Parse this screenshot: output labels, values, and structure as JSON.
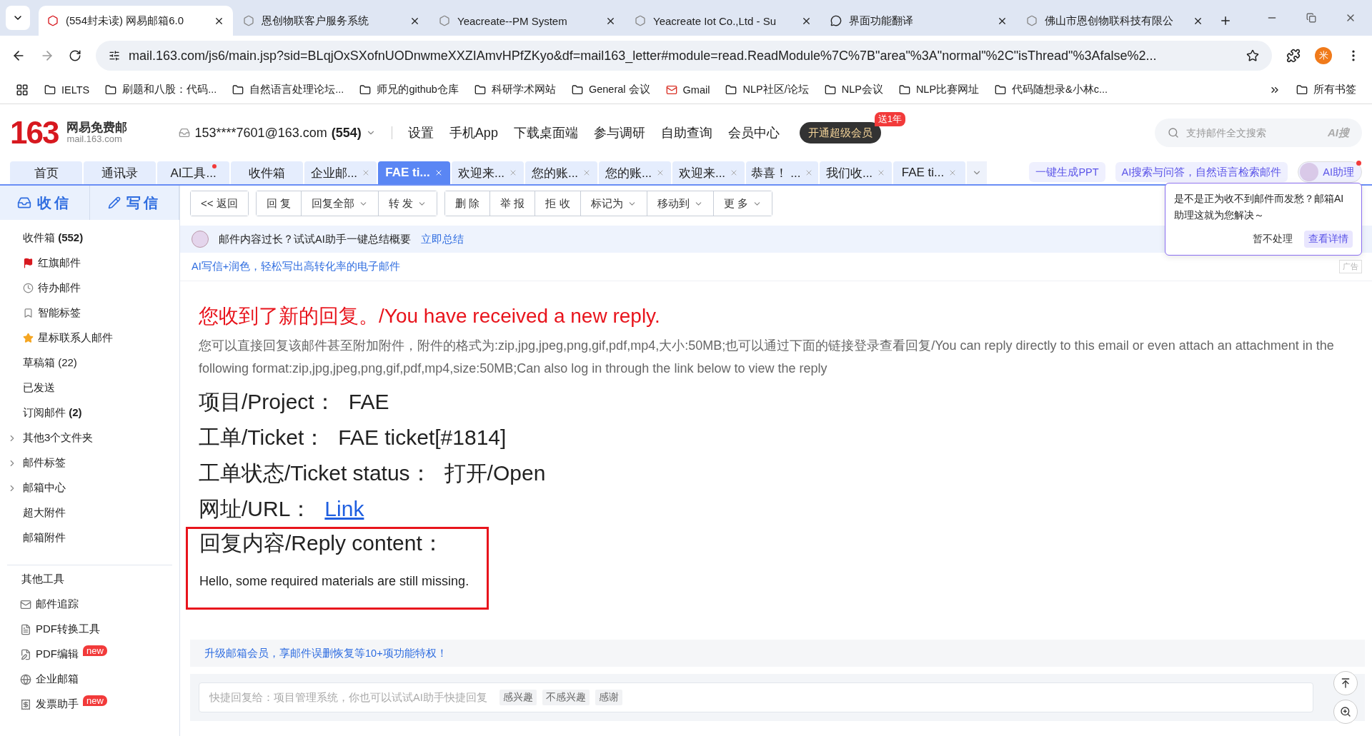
{
  "browser": {
    "tabs": [
      {
        "title": "(554封未读) 网易邮箱6.0",
        "kind": "mail",
        "selected": true
      },
      {
        "title": "恩创物联客户服务系统",
        "kind": "site",
        "selected": false
      },
      {
        "title": "Yeacreate--PM System",
        "kind": "site",
        "selected": false
      },
      {
        "title": "Yeacreate Iot Co.,Ltd - Su",
        "kind": "site",
        "selected": false
      },
      {
        "title": "界面功能翻译",
        "kind": "chat",
        "selected": false
      },
      {
        "title": "佛山市恩创物联科技有限公",
        "kind": "site",
        "selected": false
      }
    ],
    "url": "mail.163.com/js6/main.jsp?sid=BLqjOxSXofnUODnwmeXXZIAmvHPfZKyo&df=mail163_letter#module=read.ReadModule%7C%7B\"area\"%3A\"normal\"%2C\"isThread\"%3Afalse%2...",
    "profile": "米",
    "bookmarks": [
      {
        "label": "IELTS",
        "kind": "folder"
      },
      {
        "label": "刷题和八股：代码...",
        "kind": "folder"
      },
      {
        "label": "自然语言处理论坛...",
        "kind": "folder"
      },
      {
        "label": "师兄的github仓库",
        "kind": "folder"
      },
      {
        "label": "科研学术网站",
        "kind": "folder"
      },
      {
        "label": "General 会议",
        "kind": "folder"
      },
      {
        "label": "Gmail",
        "kind": "gmail"
      },
      {
        "label": "NLP社区/论坛",
        "kind": "folder"
      },
      {
        "label": "NLP会议",
        "kind": "folder"
      },
      {
        "label": "NLP比赛网址",
        "kind": "folder"
      },
      {
        "label": "代码随想录&小林c...",
        "kind": "folder"
      }
    ],
    "all_bookmarks": "所有书签"
  },
  "header": {
    "logo_number": "163",
    "logo_name": "网易免费邮",
    "logo_domain": "mail.163.com",
    "account": "153****7601@163.com",
    "account_count": "(554)",
    "nav": [
      "设置",
      "手机App",
      "下载桌面端",
      "参与调研",
      "自助查询",
      "会员中心"
    ],
    "vip_button": "开通超级会员",
    "vip_badge": "送1年",
    "search": {
      "placeholder": "支持邮件全文搜索"
    },
    "search_ai": "AI搜"
  },
  "mail_tabs": [
    {
      "label": "首页",
      "closable": false,
      "dot": false,
      "selected": false
    },
    {
      "label": "通讯录",
      "closable": false,
      "dot": false,
      "selected": false
    },
    {
      "label": "AI工具...",
      "closable": false,
      "dot": true,
      "selected": false
    },
    {
      "label": "收件箱",
      "closable": false,
      "dot": false,
      "selected": false
    },
    {
      "label": "企业邮...",
      "closable": true,
      "dot": false,
      "selected": false
    },
    {
      "label": "FAE ti...",
      "closable": true,
      "dot": false,
      "selected": true
    },
    {
      "label": "欢迎来...",
      "closable": true,
      "dot": false,
      "selected": false
    },
    {
      "label": "您的账...",
      "closable": true,
      "dot": false,
      "selected": false
    },
    {
      "label": "您的账...",
      "closable": true,
      "dot": false,
      "selected": false
    },
    {
      "label": "欢迎来...",
      "closable": true,
      "dot": false,
      "selected": false
    },
    {
      "label": "恭喜！ ...",
      "closable": true,
      "dot": false,
      "selected": false
    },
    {
      "label": "我们收...",
      "closable": true,
      "dot": false,
      "selected": false
    },
    {
      "label": "FAE ti...",
      "closable": true,
      "dot": false,
      "selected": false
    }
  ],
  "header_actions": [
    "一键生成PPT",
    "AI搜索与问答，自然语言检索邮件"
  ],
  "assistant": "AI助理",
  "sidebar": {
    "receive": "收信",
    "compose": "写信",
    "folders": [
      {
        "label": "收件箱 **(552)**",
        "kind": "plain",
        "expandable": false
      },
      {
        "label": "红旗邮件",
        "kind": "flag",
        "expandable": false
      },
      {
        "label": "待办邮件",
        "kind": "clock",
        "expandable": false
      },
      {
        "label": "智能标签",
        "kind": "bookmark",
        "expandable": false
      },
      {
        "label": "星标联系人邮件",
        "kind": "star",
        "expandable": false
      },
      {
        "label": "草稿箱 (22)",
        "kind": "plain",
        "expandable": false
      },
      {
        "label": "已发送",
        "kind": "plain",
        "expandable": false
      },
      {
        "label": "订阅邮件 **(2)**",
        "kind": "plain",
        "expandable": false
      },
      {
        "label": "其他3个文件夹",
        "kind": "plain",
        "expandable": true
      },
      {
        "label": "邮件标签",
        "kind": "plain",
        "expandable": true
      },
      {
        "label": "邮箱中心",
        "kind": "plain",
        "expandable": true
      },
      {
        "label": "超大附件",
        "kind": "plain",
        "expandable": false
      },
      {
        "label": "邮箱附件",
        "kind": "plain",
        "expandable": false
      }
    ],
    "tools_title": "其他工具",
    "tools": [
      {
        "label": "邮件追踪",
        "kind": "mail"
      },
      {
        "label": "PDF转换工具",
        "kind": "file"
      },
      {
        "label": "PDF编辑",
        "kind": "edit",
        "badge": "new"
      },
      {
        "label": "企业邮箱",
        "kind": "globe"
      },
      {
        "label": "发票助手",
        "kind": "receipt",
        "badge": "new"
      }
    ]
  },
  "toolbar": [
    [
      {
        "label": "<< 返回",
        "dropdown": false
      }
    ],
    [
      {
        "label": "回 复",
        "dropdown": false
      },
      {
        "label": "回复全部",
        "dropdown": true
      },
      {
        "label": "转 发",
        "dropdown": true
      }
    ],
    [
      {
        "label": "删 除",
        "dropdown": false
      },
      {
        "label": "举 报",
        "dropdown": false
      },
      {
        "label": "拒 收",
        "dropdown": false
      },
      {
        "label": "标记为",
        "dropdown": true
      },
      {
        "label": "移动到",
        "dropdown": true
      },
      {
        "label": "更 多",
        "dropdown": true
      }
    ]
  ],
  "ai_banner": {
    "text": "邮件内容过长？试试AI助手一键总结概要",
    "link": "立即总结"
  },
  "popup": {
    "text": "是不是正为收不到邮件而发愁？邮箱AI助理这就为您解决～",
    "buttons": [
      {
        "label": "暂不处理",
        "primary": false
      },
      {
        "label": "查看详情",
        "primary": true
      }
    ]
  },
  "ad": {
    "text": "AI写信+润色，轻松写出高转化率的电子邮件",
    "tag": "广告"
  },
  "email": {
    "headline": "您收到了新的回复。/You have received a new reply.",
    "intro": "您可以直接回复该邮件甚至附加附件，附件的格式为:zip,jpg,jpeg,png,gif,pdf,mp4,大小:50MB;也可以通过下面的链接登录查看回复/You can reply directly to this email or even attach an attachment in the following format:zip,jpg,jpeg,png,gif,pdf,mp4,size:50MB;Can also log in through the link below to view the reply",
    "fields": [
      {
        "label": "项目/Project：",
        "value": "FAE",
        "kind": "text"
      },
      {
        "label": "工单/Ticket：",
        "value": "FAE ticket[#1814]",
        "kind": "text"
      },
      {
        "label": "工单状态/Ticket status：",
        "value": "打开/Open",
        "kind": "text"
      },
      {
        "label": "网址/URL：",
        "value": "Link",
        "kind": "link"
      }
    ],
    "reply_label": "回复内容/Reply content：",
    "reply_text": "Hello, some required materials are still missing."
  },
  "upgrade": "升级邮箱会员，享邮件误删恢复等10+项功能特权！",
  "quick_reply": {
    "placeholder": "快捷回复给：项目管理系统，你也可以试试AI助手快捷回复",
    "chips": [
      "感兴趣",
      "不感兴趣",
      "感谢"
    ]
  }
}
